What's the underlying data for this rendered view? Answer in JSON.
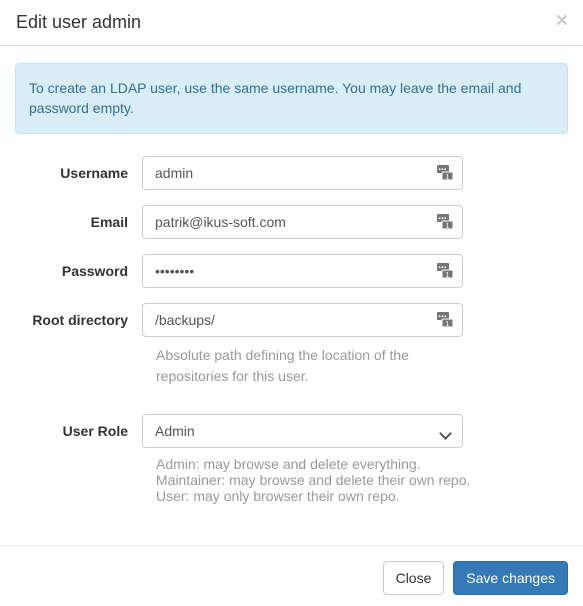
{
  "dialog": {
    "title": "Edit user admin",
    "close_icon": "close-icon",
    "close_glyph": "×"
  },
  "alert": {
    "type": "info",
    "text": "To create an LDAP user, use the same username. You may leave the email and password empty.",
    "bg_color": "#d9edf7",
    "border_color": "#bce8f1",
    "text_color": "#31708f"
  },
  "form": {
    "fields": [
      {
        "label": "Username",
        "name": "username",
        "type": "text",
        "value": "admin",
        "placeholder": "",
        "icon": "password-manager-icon"
      },
      {
        "label": "Email",
        "name": "email",
        "type": "text",
        "value": "patrik@ikus-soft.com",
        "placeholder": "",
        "icon": "password-manager-icon"
      },
      {
        "label": "Password",
        "name": "password",
        "type": "password",
        "value": "••••••••",
        "placeholder": "",
        "icon": "password-manager-icon"
      },
      {
        "label": "Root directory",
        "name": "root-directory",
        "type": "text",
        "value": "/backups/",
        "placeholder": "",
        "icon": "password-manager-icon",
        "help": "Absolute path defining the location of the repositories for this user."
      }
    ],
    "user_role": {
      "label": "User Role",
      "selected": "Admin",
      "options": [
        "Admin",
        "Maintainer",
        "User"
      ],
      "chevron_icon": "chevron-down-icon",
      "help_lines": [
        "Admin: may browse and delete everything.",
        "Maintainer: may browse and delete their own repo.",
        "User: may only browser their own repo."
      ]
    }
  },
  "footer": {
    "close_label": "Close",
    "save_label": "Save changes",
    "primary_color": "#337ab7"
  }
}
